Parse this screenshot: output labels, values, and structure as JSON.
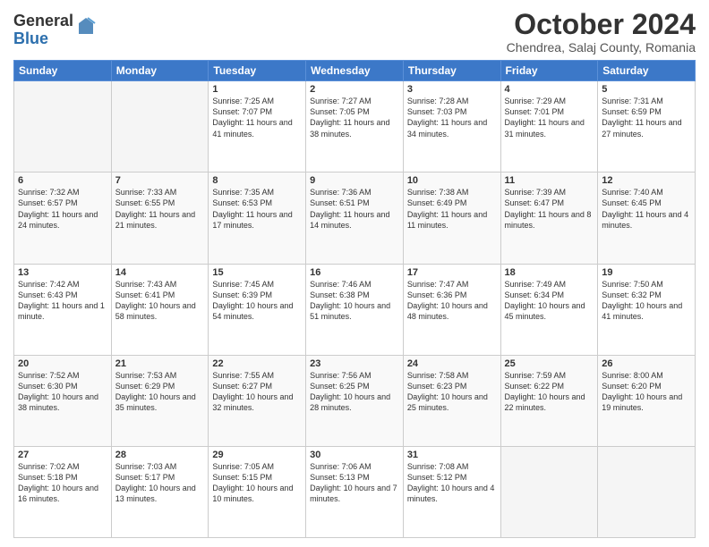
{
  "logo": {
    "general": "General",
    "blue": "Blue"
  },
  "title": "October 2024",
  "location": "Chendrea, Salaj County, Romania",
  "days_header": [
    "Sunday",
    "Monday",
    "Tuesday",
    "Wednesday",
    "Thursday",
    "Friday",
    "Saturday"
  ],
  "weeks": [
    [
      {
        "day": "",
        "info": ""
      },
      {
        "day": "",
        "info": ""
      },
      {
        "day": "1",
        "info": "Sunrise: 7:25 AM\nSunset: 7:07 PM\nDaylight: 11 hours and 41 minutes."
      },
      {
        "day": "2",
        "info": "Sunrise: 7:27 AM\nSunset: 7:05 PM\nDaylight: 11 hours and 38 minutes."
      },
      {
        "day": "3",
        "info": "Sunrise: 7:28 AM\nSunset: 7:03 PM\nDaylight: 11 hours and 34 minutes."
      },
      {
        "day": "4",
        "info": "Sunrise: 7:29 AM\nSunset: 7:01 PM\nDaylight: 11 hours and 31 minutes."
      },
      {
        "day": "5",
        "info": "Sunrise: 7:31 AM\nSunset: 6:59 PM\nDaylight: 11 hours and 27 minutes."
      }
    ],
    [
      {
        "day": "6",
        "info": "Sunrise: 7:32 AM\nSunset: 6:57 PM\nDaylight: 11 hours and 24 minutes."
      },
      {
        "day": "7",
        "info": "Sunrise: 7:33 AM\nSunset: 6:55 PM\nDaylight: 11 hours and 21 minutes."
      },
      {
        "day": "8",
        "info": "Sunrise: 7:35 AM\nSunset: 6:53 PM\nDaylight: 11 hours and 17 minutes."
      },
      {
        "day": "9",
        "info": "Sunrise: 7:36 AM\nSunset: 6:51 PM\nDaylight: 11 hours and 14 minutes."
      },
      {
        "day": "10",
        "info": "Sunrise: 7:38 AM\nSunset: 6:49 PM\nDaylight: 11 hours and 11 minutes."
      },
      {
        "day": "11",
        "info": "Sunrise: 7:39 AM\nSunset: 6:47 PM\nDaylight: 11 hours and 8 minutes."
      },
      {
        "day": "12",
        "info": "Sunrise: 7:40 AM\nSunset: 6:45 PM\nDaylight: 11 hours and 4 minutes."
      }
    ],
    [
      {
        "day": "13",
        "info": "Sunrise: 7:42 AM\nSunset: 6:43 PM\nDaylight: 11 hours and 1 minute."
      },
      {
        "day": "14",
        "info": "Sunrise: 7:43 AM\nSunset: 6:41 PM\nDaylight: 10 hours and 58 minutes."
      },
      {
        "day": "15",
        "info": "Sunrise: 7:45 AM\nSunset: 6:39 PM\nDaylight: 10 hours and 54 minutes."
      },
      {
        "day": "16",
        "info": "Sunrise: 7:46 AM\nSunset: 6:38 PM\nDaylight: 10 hours and 51 minutes."
      },
      {
        "day": "17",
        "info": "Sunrise: 7:47 AM\nSunset: 6:36 PM\nDaylight: 10 hours and 48 minutes."
      },
      {
        "day": "18",
        "info": "Sunrise: 7:49 AM\nSunset: 6:34 PM\nDaylight: 10 hours and 45 minutes."
      },
      {
        "day": "19",
        "info": "Sunrise: 7:50 AM\nSunset: 6:32 PM\nDaylight: 10 hours and 41 minutes."
      }
    ],
    [
      {
        "day": "20",
        "info": "Sunrise: 7:52 AM\nSunset: 6:30 PM\nDaylight: 10 hours and 38 minutes."
      },
      {
        "day": "21",
        "info": "Sunrise: 7:53 AM\nSunset: 6:29 PM\nDaylight: 10 hours and 35 minutes."
      },
      {
        "day": "22",
        "info": "Sunrise: 7:55 AM\nSunset: 6:27 PM\nDaylight: 10 hours and 32 minutes."
      },
      {
        "day": "23",
        "info": "Sunrise: 7:56 AM\nSunset: 6:25 PM\nDaylight: 10 hours and 28 minutes."
      },
      {
        "day": "24",
        "info": "Sunrise: 7:58 AM\nSunset: 6:23 PM\nDaylight: 10 hours and 25 minutes."
      },
      {
        "day": "25",
        "info": "Sunrise: 7:59 AM\nSunset: 6:22 PM\nDaylight: 10 hours and 22 minutes."
      },
      {
        "day": "26",
        "info": "Sunrise: 8:00 AM\nSunset: 6:20 PM\nDaylight: 10 hours and 19 minutes."
      }
    ],
    [
      {
        "day": "27",
        "info": "Sunrise: 7:02 AM\nSunset: 5:18 PM\nDaylight: 10 hours and 16 minutes."
      },
      {
        "day": "28",
        "info": "Sunrise: 7:03 AM\nSunset: 5:17 PM\nDaylight: 10 hours and 13 minutes."
      },
      {
        "day": "29",
        "info": "Sunrise: 7:05 AM\nSunset: 5:15 PM\nDaylight: 10 hours and 10 minutes."
      },
      {
        "day": "30",
        "info": "Sunrise: 7:06 AM\nSunset: 5:13 PM\nDaylight: 10 hours and 7 minutes."
      },
      {
        "day": "31",
        "info": "Sunrise: 7:08 AM\nSunset: 5:12 PM\nDaylight: 10 hours and 4 minutes."
      },
      {
        "day": "",
        "info": ""
      },
      {
        "day": "",
        "info": ""
      }
    ]
  ]
}
